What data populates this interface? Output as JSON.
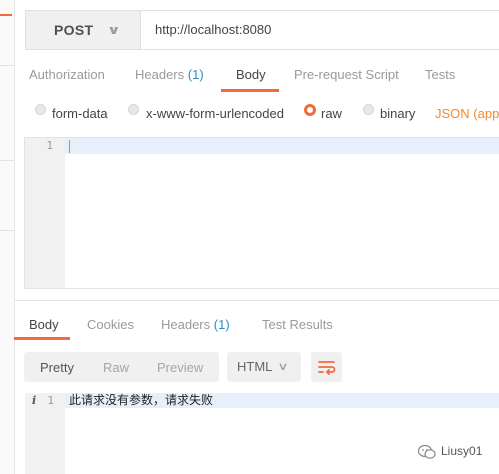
{
  "request": {
    "method": "POST",
    "url": "http://localhost:8080"
  },
  "request_tabs": {
    "authorization": "Authorization",
    "headers": "Headers",
    "headers_count": "(1)",
    "body": "Body",
    "prerequest": "Pre-request Script",
    "tests": "Tests"
  },
  "body_modes": {
    "form_data": "form-data",
    "urlencoded": "x-www-form-urlencoded",
    "raw": "raw",
    "binary": "binary",
    "selected": "raw",
    "content_type": "JSON (appli"
  },
  "editor": {
    "line_numbers": [
      "1"
    ],
    "content": ""
  },
  "response_tabs": {
    "body": "Body",
    "cookies": "Cookies",
    "headers": "Headers",
    "headers_count": "(1)",
    "test_results": "Test Results"
  },
  "response_view": {
    "pretty": "Pretty",
    "raw": "Raw",
    "preview": "Preview",
    "format": "HTML",
    "line_number": "1",
    "line_text": "此请求没有参数，请求失败"
  },
  "watermark": {
    "text": "Liusy01"
  },
  "colors": {
    "accent": "#f26b3a",
    "link": "#2a8fbd",
    "content_type": "#f08a2c"
  }
}
